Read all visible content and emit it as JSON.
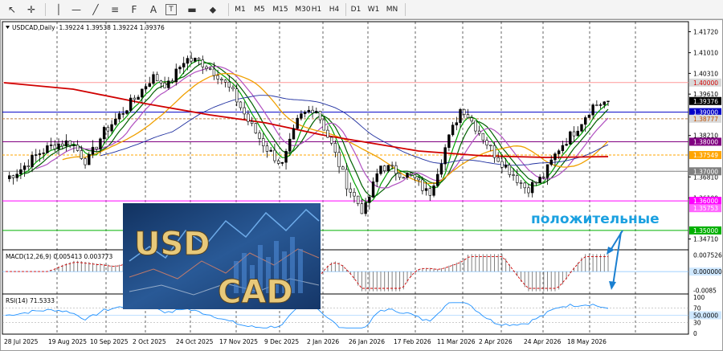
{
  "toolbar": {
    "cursor_icon": "↖",
    "crosshair_icon": "✛",
    "hline_icon": "—",
    "trendline_icon": "╱",
    "equidistant_icon": "≡",
    "fibo_icon": "F",
    "text_icon": "A",
    "label_icon": "T",
    "arrow_icon": "▬",
    "shapes_icon": "⬥",
    "timeframes": [
      "M1",
      "M5",
      "M15",
      "M30",
      "H1",
      "H4",
      "D1",
      "W1",
      "MN"
    ]
  },
  "chart": {
    "title": "USDCAD,Daily",
    "ohlc": "1.39224 1.39538 1.39224 1.39376",
    "axis_labels": [
      {
        "v": "1.41720",
        "y": 1.4172
      },
      {
        "v": "1.41010",
        "y": 1.4101
      },
      {
        "v": "1.40310",
        "y": 1.4031
      },
      {
        "v": "1.39610",
        "y": 1.3961
      },
      {
        "v": "1.38210",
        "y": 1.3821
      },
      {
        "v": "1.36810",
        "y": 1.3681
      },
      {
        "v": "1.36100",
        "y": 1.361
      },
      {
        "v": "1.34710",
        "y": 1.3471
      }
    ],
    "level_labels": [
      {
        "v": "1.40000",
        "y": 1.4,
        "bg": "#d9d9d9",
        "fg": "#d40000",
        "line": "#ff9999",
        "dash": "0"
      },
      {
        "v": "1.39376",
        "y": 1.39376,
        "bg": "#000000",
        "fg": "#ffffff",
        "line": "",
        "dash": "0"
      },
      {
        "v": "1.39000",
        "y": 1.39,
        "bg": "#0000c8",
        "fg": "#ffffff",
        "line": "#0000c8",
        "dash": "0"
      },
      {
        "v": "1.38777",
        "y": 1.38777,
        "bg": "#d9d9d9",
        "fg": "#c05000",
        "line": "#c08040",
        "dash": "3,2"
      },
      {
        "v": "1.38000",
        "y": 1.38,
        "bg": "#800080",
        "fg": "#ffffff",
        "line": "#800080",
        "dash": "0"
      },
      {
        "v": "1.37549",
        "y": 1.37549,
        "bg": "#ffa500",
        "fg": "#ffffff",
        "line": "#ffa500",
        "dash": "3,2"
      },
      {
        "v": "1.37000",
        "y": 1.37,
        "bg": "#808080",
        "fg": "#ffffff",
        "line": "#808080",
        "dash": "0"
      },
      {
        "v": "1.36000",
        "y": 1.36,
        "bg": "#ff00ff",
        "fg": "#ffffff",
        "line": "#ff00ff",
        "dash": "0"
      },
      {
        "v": "1.35753",
        "y": 1.35753,
        "bg": "#ff66ff",
        "fg": "#ffffff",
        "line": "",
        "dash": "0"
      },
      {
        "v": "1.35000",
        "y": 1.35,
        "bg": "#00b000",
        "fg": "#ffffff",
        "line": "#00b000",
        "dash": "0"
      }
    ],
    "annotation": "положительные",
    "logo_text_1": "USD",
    "logo_text_2": "CAD"
  },
  "macd": {
    "title": "MACD(12,26,9) 0.005413 0.003773",
    "axis_labels": [
      {
        "v": "0.007526",
        "y": 0.007526
      },
      {
        "v": "0.000000",
        "y": 0.0
      },
      {
        "v": "-0.0085",
        "y": -0.0085
      }
    ]
  },
  "rsi": {
    "title": "RSI(14) 71.5333",
    "axis_labels": [
      {
        "v": "100",
        "y": 100
      },
      {
        "v": "70",
        "y": 70
      },
      {
        "v": "50.0000",
        "y": 50
      },
      {
        "v": "30",
        "y": 30
      },
      {
        "v": "0",
        "y": 0
      }
    ]
  },
  "dates": [
    "28 Jul 2025",
    "19 Aug 2025",
    "10 Sep 2025",
    "2 Oct 2025",
    "24 Oct 2025",
    "17 Nov 2025",
    "9 Dec 2025",
    "2 Jan 2026",
    "26 Jan 2026",
    "17 Feb 2026",
    "11 Mar 2026",
    "2 Apr 2026",
    "24 Apr 2026",
    "18 May 2026"
  ],
  "chart_data": {
    "type": "line",
    "title": "USDCAD,Daily",
    "series": [
      {
        "name": "USDCAD",
        "values": [
          1.3675,
          1.371,
          1.376,
          1.379,
          1.38,
          1.373,
          1.383,
          1.389,
          1.395,
          1.402,
          1.399,
          1.408,
          1.407,
          1.403,
          1.396,
          1.386,
          1.378,
          1.372,
          1.388,
          1.392,
          1.379,
          1.365,
          1.356,
          1.372,
          1.37,
          1.368,
          1.362,
          1.378,
          1.392,
          1.384,
          1.376,
          1.37,
          1.364,
          1.368,
          1.378,
          1.384,
          1.392,
          1.39376
        ]
      }
    ],
    "ylim": [
      1.3471,
      1.4172
    ]
  }
}
